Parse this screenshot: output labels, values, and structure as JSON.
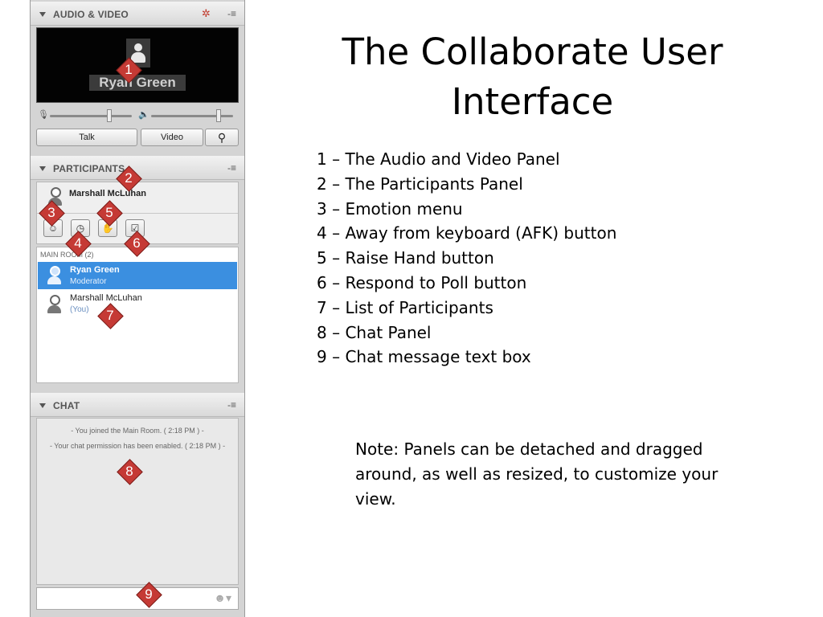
{
  "slide": {
    "title": "The Collaborate User Interface",
    "legend": [
      "1 – The Audio and Video Panel",
      "2 – The Participants Panel",
      "3 – Emotion menu",
      "4 – Away from keyboard (AFK) button",
      "5 – Raise Hand button",
      "6 – Respond to Poll button",
      "7 – List of Participants",
      "8 – Chat Panel",
      "9 – Chat message text box"
    ],
    "note": "Note: Panels can be detached and dragged around, as well as resized, to customize your view."
  },
  "callouts": [
    "1",
    "2",
    "3",
    "4",
    "5",
    "6",
    "7",
    "8",
    "9"
  ],
  "audio_video": {
    "title": "AUDIO & VIDEO",
    "menu_glyph": "-≡",
    "video_name": "Ryan Green",
    "talk_label": "Talk",
    "video_label": "Video"
  },
  "participants": {
    "title": "PARTICIPANTS",
    "menu_glyph": "-≡",
    "self_name": "Marshall McLuhan",
    "room_label": "MAIN ROOM (2)",
    "list": [
      {
        "name": "Ryan Green",
        "role": "Moderator"
      },
      {
        "name": "Marshall McLuhan",
        "role": "(You)"
      }
    ]
  },
  "chat": {
    "title": "CHAT",
    "menu_glyph": "-≡",
    "messages": [
      "- You joined the Main Room. ( 2:18 PM ) -",
      "- Your chat permission has been enabled. ( 2:18 PM ) -"
    ]
  },
  "colors": {
    "callout": "#c53a35",
    "selected_row": "#3b8fe0",
    "panel_bg": "#d4d4d4"
  },
  "icons": [
    "triangle-down-icon",
    "network-icon",
    "microphone-icon",
    "speaker-icon",
    "search-people-icon",
    "person-icon",
    "smiley-icon",
    "clock-icon",
    "hand-icon",
    "checkbox-icon",
    "emoticon-icon"
  ]
}
